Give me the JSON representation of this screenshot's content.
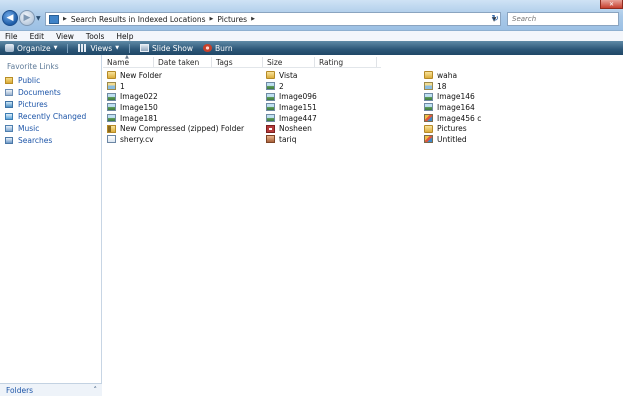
{
  "address": {
    "breadcrumbs": [
      "Search Results in Indexed Locations",
      "Pictures"
    ],
    "search_placeholder": "Search"
  },
  "menu": [
    "File",
    "Edit",
    "View",
    "Tools",
    "Help"
  ],
  "toolbar": {
    "organize": "Organize",
    "views": "Views",
    "slideshow": "Slide Show",
    "burn": "Burn"
  },
  "navpane": {
    "heading": "Favorite Links",
    "links": [
      {
        "label": "Public",
        "icon": "folder-icon"
      },
      {
        "label": "Documents",
        "icon": "documents-icon"
      },
      {
        "label": "Pictures",
        "icon": "pictures-icon"
      },
      {
        "label": "Recently Changed",
        "icon": "recently-changed-icon"
      },
      {
        "label": "Music",
        "icon": "music-icon"
      },
      {
        "label": "Searches",
        "icon": "searches-icon"
      }
    ],
    "folders_label": "Folders"
  },
  "columns": [
    "Name",
    "Date taken",
    "Tags",
    "Size",
    "Rating"
  ],
  "files": {
    "col1": [
      {
        "name": "New Folder",
        "icon": "folder"
      },
      {
        "name": "1",
        "icon": "imagefolder"
      },
      {
        "name": "Image022",
        "icon": "image"
      },
      {
        "name": "Image150",
        "icon": "image"
      },
      {
        "name": "Image181",
        "icon": "image"
      },
      {
        "name": "New Compressed (zipped) Folder",
        "icon": "zip"
      },
      {
        "name": "sherry.cv",
        "icon": "doc"
      }
    ],
    "col2": [
      {
        "name": "Vista",
        "icon": "folder"
      },
      {
        "name": "2",
        "icon": "image"
      },
      {
        "name": "Image096",
        "icon": "image"
      },
      {
        "name": "Image151",
        "icon": "image"
      },
      {
        "name": "Image447",
        "icon": "image"
      },
      {
        "name": "Nosheen",
        "icon": "docx"
      },
      {
        "name": "tariq",
        "icon": "tariq"
      }
    ],
    "col3": [
      {
        "name": "waha",
        "icon": "folder"
      },
      {
        "name": "18",
        "icon": "imagefolder"
      },
      {
        "name": "Image146",
        "icon": "image"
      },
      {
        "name": "Image164",
        "icon": "image"
      },
      {
        "name": "Image456 c",
        "icon": "paint"
      },
      {
        "name": "Pictures",
        "icon": "folder"
      },
      {
        "name": "Untitled",
        "icon": "paint"
      }
    ]
  }
}
